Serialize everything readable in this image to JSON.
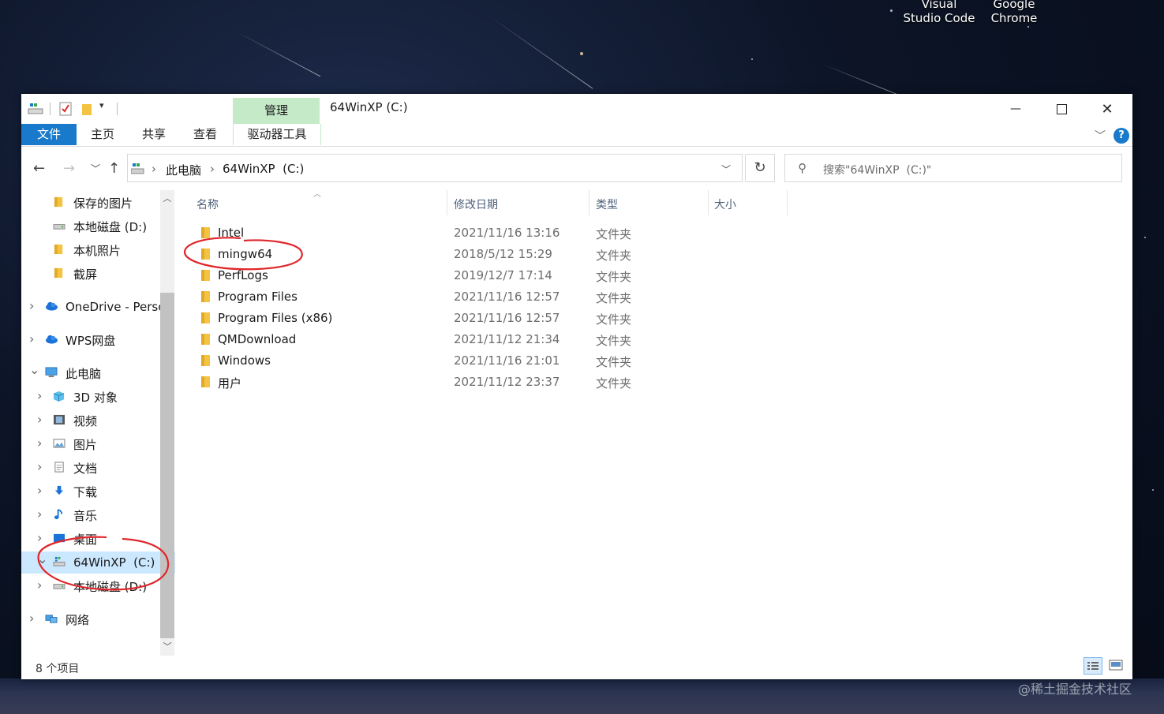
{
  "desktop": {
    "icons": [
      {
        "label_top": "Visual",
        "label_bottom": "Studio Code"
      },
      {
        "label_top": "Google",
        "label_bottom": "Chrome"
      }
    ],
    "watermark": "@稀土掘金技术社区"
  },
  "window": {
    "title": "64WinXP  (C:)",
    "context_tab_group": "管理",
    "controls": {
      "minimize": "—",
      "maximize": "☐",
      "close": "✕"
    }
  },
  "ribbon": {
    "tabs": [
      "文件",
      "主页",
      "共享",
      "查看"
    ],
    "context_tab": "驱动器工具",
    "help": "?"
  },
  "address": {
    "crumbs": [
      "此电脑",
      "64WinXP  (C:)"
    ],
    "search_placeholder": "搜索\"64WinXP  (C:)\""
  },
  "nav": {
    "items": [
      {
        "label": "保存的图片",
        "icon": "folder-icon"
      },
      {
        "label": "本地磁盘 (D:)",
        "icon": "drive-icon"
      },
      {
        "label": "本机照片",
        "icon": "folder-icon"
      },
      {
        "label": "截屏",
        "icon": "folder-icon"
      },
      {
        "label": "OneDrive - Persc",
        "icon": "cloud-icon"
      },
      {
        "label": "WPS网盘",
        "icon": "cloud-icon"
      },
      {
        "label": "此电脑",
        "icon": "computer-icon"
      },
      {
        "label": "3D 对象",
        "icon": "cube-icon"
      },
      {
        "label": "视频",
        "icon": "video-icon"
      },
      {
        "label": "图片",
        "icon": "picture-icon"
      },
      {
        "label": "文档",
        "icon": "document-icon"
      },
      {
        "label": "下载",
        "icon": "download-icon"
      },
      {
        "label": "音乐",
        "icon": "music-icon"
      },
      {
        "label": "桌面",
        "icon": "desktop-icon"
      },
      {
        "label": "64WinXP  (C:)",
        "icon": "windows-drive-icon"
      },
      {
        "label": "本地磁盘 (D:)",
        "icon": "drive-icon"
      },
      {
        "label": "网络",
        "icon": "network-icon"
      }
    ]
  },
  "columns": {
    "name": "名称",
    "modified": "修改日期",
    "type": "类型",
    "size": "大小"
  },
  "files": [
    {
      "name": "Intel",
      "modified": "2021/11/16 13:16",
      "type": "文件夹"
    },
    {
      "name": "mingw64",
      "modified": "2018/5/12 15:29",
      "type": "文件夹"
    },
    {
      "name": "PerfLogs",
      "modified": "2019/12/7 17:14",
      "type": "文件夹"
    },
    {
      "name": "Program Files",
      "modified": "2021/11/16 12:57",
      "type": "文件夹"
    },
    {
      "name": "Program Files (x86)",
      "modified": "2021/11/16 12:57",
      "type": "文件夹"
    },
    {
      "name": "QMDownload",
      "modified": "2021/11/12 21:34",
      "type": "文件夹"
    },
    {
      "name": "Windows",
      "modified": "2021/11/16 21:01",
      "type": "文件夹"
    },
    {
      "name": "用户",
      "modified": "2021/11/12 23:37",
      "type": "文件夹"
    }
  ],
  "status": {
    "item_count": "8 个项目"
  },
  "colors": {
    "accent": "#1979ca",
    "selection": "#cce8ff",
    "context_tab": "#c5eac8",
    "annotation": "#e0262a"
  }
}
